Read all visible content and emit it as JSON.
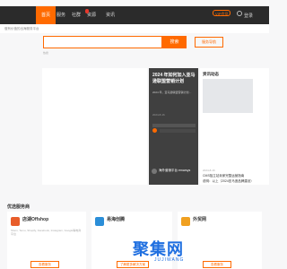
{
  "topbar": {
    "left": "",
    "right": ""
  },
  "nav": {
    "tabs": [
      {
        "label": "首页",
        "active": true
      },
      {
        "label": "服务",
        "active": false
      },
      {
        "label": "社群",
        "active": false
      },
      {
        "label": "资源",
        "active": false
      },
      {
        "label": "资讯",
        "active": false
      }
    ],
    "badge": "",
    "vip_label": "VIP会员",
    "user_area": "登录"
  },
  "subheader": {
    "text": "做有价值的出海服务平台"
  },
  "search": {
    "placeholder": "",
    "button_label": "搜索",
    "outline_button_label": "服务导航",
    "hint": "热搜"
  },
  "featured": {
    "title": "2024 年如何加入亚马逊联盟营销计划",
    "description": "2024 年，亚马逊联盟营销计划…",
    "date": "2024-8-16",
    "footer_title": "海外营销平台 emarsys",
    "footer_desc": ""
  },
  "news": {
    "heading": "资讯动态",
    "date": "2024-8-16",
    "items": [
      "CMS独立站卖家完整运营指南",
      "说明：以上（2024亚马逊品牌建设）"
    ]
  },
  "tools_section": {
    "title": "优选服务商"
  },
  "tools": [
    {
      "name": "店湖Offshop",
      "desc": "",
      "detail": "Shein, Temu, Shopify, Facebook, Instagram, Google等电商平台",
      "button": "查看服务",
      "icon_color": "#e85d2a"
    },
    {
      "name": "易海创腾",
      "desc": "",
      "detail": "",
      "button": "了解更多解决方案",
      "icon_color": "#2b8ed8"
    },
    {
      "name": "外贸网",
      "desc": "",
      "detail": "",
      "button": "查看服务",
      "icon_color": "#f0a020"
    }
  ],
  "watermark": {
    "main": "聚集网",
    "sub": "JUJIWANG"
  }
}
